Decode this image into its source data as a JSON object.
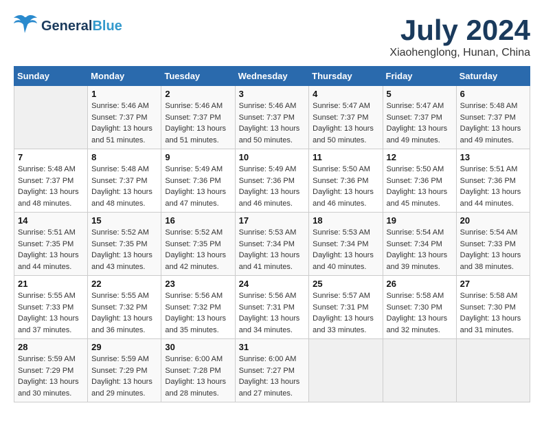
{
  "header": {
    "logo_general": "General",
    "logo_blue": "Blue",
    "month_year": "July 2024",
    "location": "Xiaohenglong, Hunan, China"
  },
  "weekdays": [
    "Sunday",
    "Monday",
    "Tuesday",
    "Wednesday",
    "Thursday",
    "Friday",
    "Saturday"
  ],
  "weeks": [
    [
      null,
      {
        "day": 1,
        "sunrise": "5:46 AM",
        "sunset": "7:37 PM",
        "daylight": "13 hours and 51 minutes."
      },
      {
        "day": 2,
        "sunrise": "5:46 AM",
        "sunset": "7:37 PM",
        "daylight": "13 hours and 51 minutes."
      },
      {
        "day": 3,
        "sunrise": "5:46 AM",
        "sunset": "7:37 PM",
        "daylight": "13 hours and 50 minutes."
      },
      {
        "day": 4,
        "sunrise": "5:47 AM",
        "sunset": "7:37 PM",
        "daylight": "13 hours and 50 minutes."
      },
      {
        "day": 5,
        "sunrise": "5:47 AM",
        "sunset": "7:37 PM",
        "daylight": "13 hours and 49 minutes."
      },
      {
        "day": 6,
        "sunrise": "5:48 AM",
        "sunset": "7:37 PM",
        "daylight": "13 hours and 49 minutes."
      }
    ],
    [
      {
        "day": 7,
        "sunrise": "5:48 AM",
        "sunset": "7:37 PM",
        "daylight": "13 hours and 48 minutes."
      },
      {
        "day": 8,
        "sunrise": "5:48 AM",
        "sunset": "7:37 PM",
        "daylight": "13 hours and 48 minutes."
      },
      {
        "day": 9,
        "sunrise": "5:49 AM",
        "sunset": "7:36 PM",
        "daylight": "13 hours and 47 minutes."
      },
      {
        "day": 10,
        "sunrise": "5:49 AM",
        "sunset": "7:36 PM",
        "daylight": "13 hours and 46 minutes."
      },
      {
        "day": 11,
        "sunrise": "5:50 AM",
        "sunset": "7:36 PM",
        "daylight": "13 hours and 46 minutes."
      },
      {
        "day": 12,
        "sunrise": "5:50 AM",
        "sunset": "7:36 PM",
        "daylight": "13 hours and 45 minutes."
      },
      {
        "day": 13,
        "sunrise": "5:51 AM",
        "sunset": "7:36 PM",
        "daylight": "13 hours and 44 minutes."
      }
    ],
    [
      {
        "day": 14,
        "sunrise": "5:51 AM",
        "sunset": "7:35 PM",
        "daylight": "13 hours and 44 minutes."
      },
      {
        "day": 15,
        "sunrise": "5:52 AM",
        "sunset": "7:35 PM",
        "daylight": "13 hours and 43 minutes."
      },
      {
        "day": 16,
        "sunrise": "5:52 AM",
        "sunset": "7:35 PM",
        "daylight": "13 hours and 42 minutes."
      },
      {
        "day": 17,
        "sunrise": "5:53 AM",
        "sunset": "7:34 PM",
        "daylight": "13 hours and 41 minutes."
      },
      {
        "day": 18,
        "sunrise": "5:53 AM",
        "sunset": "7:34 PM",
        "daylight": "13 hours and 40 minutes."
      },
      {
        "day": 19,
        "sunrise": "5:54 AM",
        "sunset": "7:34 PM",
        "daylight": "13 hours and 39 minutes."
      },
      {
        "day": 20,
        "sunrise": "5:54 AM",
        "sunset": "7:33 PM",
        "daylight": "13 hours and 38 minutes."
      }
    ],
    [
      {
        "day": 21,
        "sunrise": "5:55 AM",
        "sunset": "7:33 PM",
        "daylight": "13 hours and 37 minutes."
      },
      {
        "day": 22,
        "sunrise": "5:55 AM",
        "sunset": "7:32 PM",
        "daylight": "13 hours and 36 minutes."
      },
      {
        "day": 23,
        "sunrise": "5:56 AM",
        "sunset": "7:32 PM",
        "daylight": "13 hours and 35 minutes."
      },
      {
        "day": 24,
        "sunrise": "5:56 AM",
        "sunset": "7:31 PM",
        "daylight": "13 hours and 34 minutes."
      },
      {
        "day": 25,
        "sunrise": "5:57 AM",
        "sunset": "7:31 PM",
        "daylight": "13 hours and 33 minutes."
      },
      {
        "day": 26,
        "sunrise": "5:58 AM",
        "sunset": "7:30 PM",
        "daylight": "13 hours and 32 minutes."
      },
      {
        "day": 27,
        "sunrise": "5:58 AM",
        "sunset": "7:30 PM",
        "daylight": "13 hours and 31 minutes."
      }
    ],
    [
      {
        "day": 28,
        "sunrise": "5:59 AM",
        "sunset": "7:29 PM",
        "daylight": "13 hours and 30 minutes."
      },
      {
        "day": 29,
        "sunrise": "5:59 AM",
        "sunset": "7:29 PM",
        "daylight": "13 hours and 29 minutes."
      },
      {
        "day": 30,
        "sunrise": "6:00 AM",
        "sunset": "7:28 PM",
        "daylight": "13 hours and 28 minutes."
      },
      {
        "day": 31,
        "sunrise": "6:00 AM",
        "sunset": "7:27 PM",
        "daylight": "13 hours and 27 minutes."
      },
      null,
      null,
      null
    ]
  ]
}
